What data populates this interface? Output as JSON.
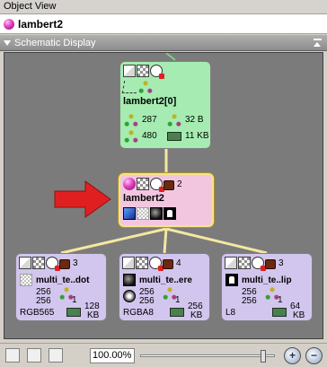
{
  "window": {
    "title": "Object View"
  },
  "object": {
    "name": "lambert2"
  },
  "panel": {
    "title": "Schematic Display"
  },
  "nodes": {
    "top": {
      "name": "lambert2[0]",
      "tris": "287",
      "verts": "480",
      "size_a": "32 B",
      "size_b": "11 KB"
    },
    "mid": {
      "name": "lambert2",
      "count": "2"
    },
    "low": [
      {
        "name": "multi_te..dot",
        "count": "3",
        "w": "256",
        "h": "256",
        "mips": "1",
        "format": "RGB565",
        "size": "128",
        "unit": "KB"
      },
      {
        "name": "multi_te..ere",
        "count": "4",
        "w": "256",
        "h": "256",
        "mips": "1",
        "format": "RGBA8",
        "size": "256",
        "unit": "KB"
      },
      {
        "name": "multi_te..lip",
        "count": "3",
        "w": "256",
        "h": "256",
        "mips": "1",
        "format": "L8",
        "size": "64",
        "unit": "KB"
      }
    ]
  },
  "statusbar": {
    "zoom": "100.00%",
    "zoom_in": "+",
    "zoom_out": "−",
    "zoom_slider": 0.94
  },
  "colors": {
    "node_top": "#a6ecb2",
    "node_mid": "#f3c6e0",
    "node_low": "#d2c6ee",
    "highlight_arrow": "#e02020",
    "wire": "#f4e8a0"
  }
}
